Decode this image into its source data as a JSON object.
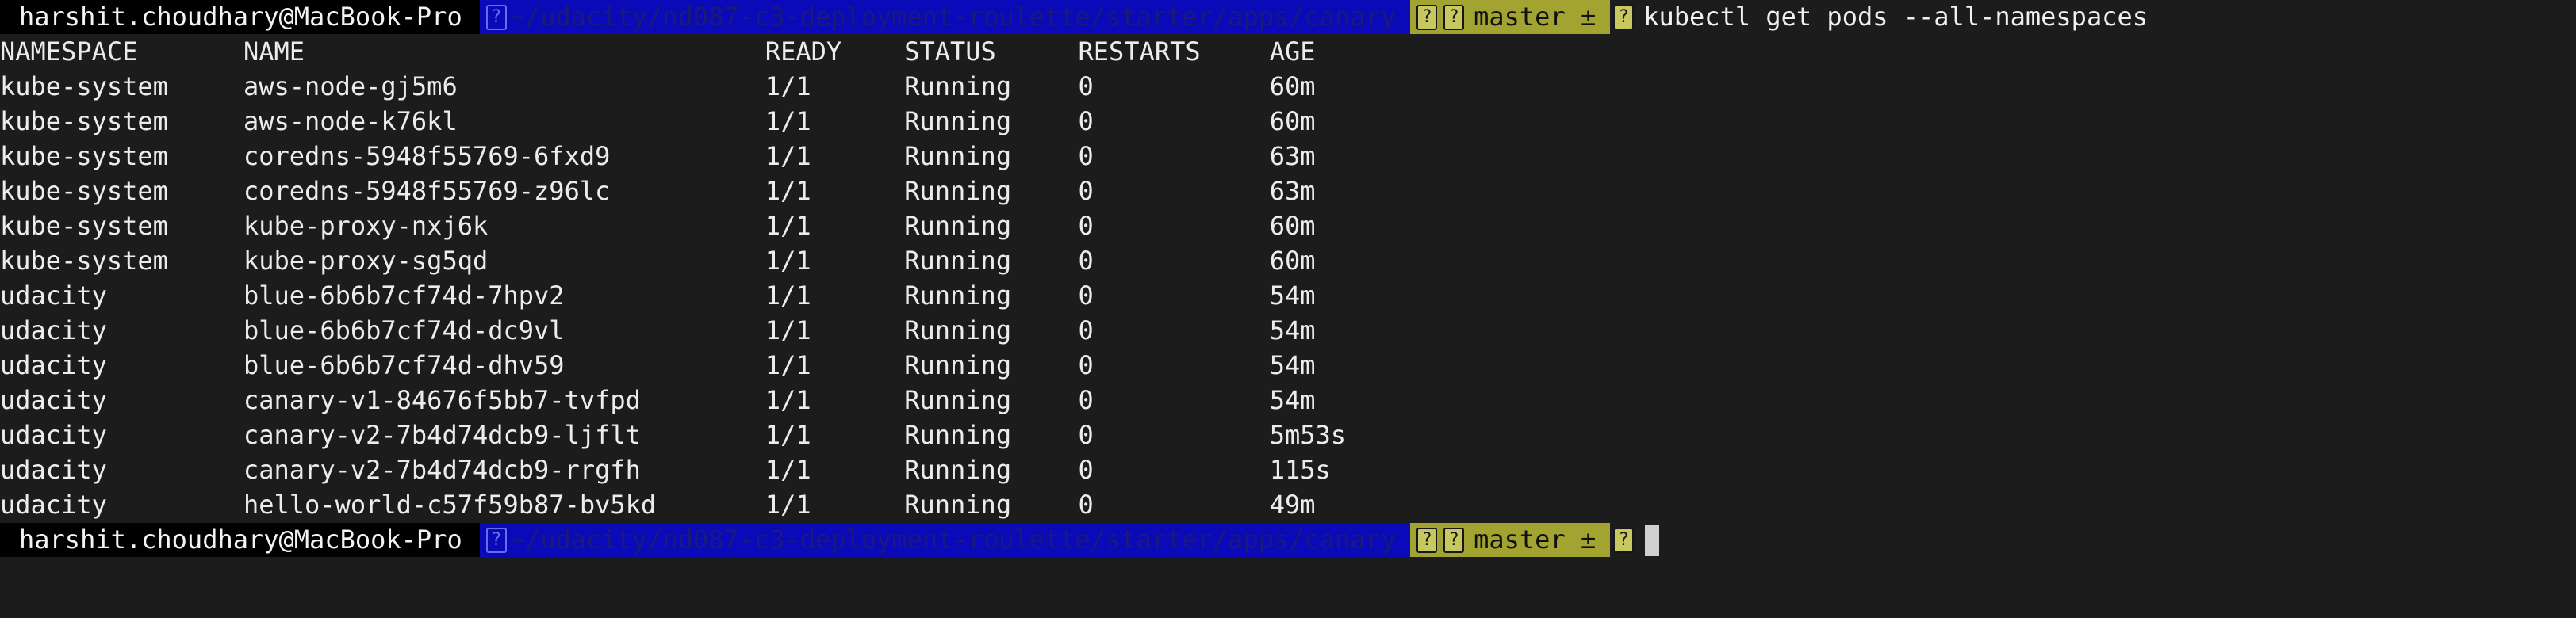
{
  "prompt": {
    "user_host": "harshit.choudhary@MacBook-Pro",
    "path": "~/udacity/nd087-c3-deployment-roulette/starter/apps/canary",
    "branch": "master ±",
    "command": "kubectl get pods --all-namespaces",
    "glyph": "?"
  },
  "table": {
    "headers": [
      "NAMESPACE",
      "NAME",
      "READY",
      "STATUS",
      "RESTARTS",
      "AGE"
    ],
    "rows": [
      [
        "kube-system",
        "aws-node-gj5m6",
        "1/1",
        "Running",
        "0",
        "60m"
      ],
      [
        "kube-system",
        "aws-node-k76kl",
        "1/1",
        "Running",
        "0",
        "60m"
      ],
      [
        "kube-system",
        "coredns-5948f55769-6fxd9",
        "1/1",
        "Running",
        "0",
        "63m"
      ],
      [
        "kube-system",
        "coredns-5948f55769-z96lc",
        "1/1",
        "Running",
        "0",
        "63m"
      ],
      [
        "kube-system",
        "kube-proxy-nxj6k",
        "1/1",
        "Running",
        "0",
        "60m"
      ],
      [
        "kube-system",
        "kube-proxy-sg5qd",
        "1/1",
        "Running",
        "0",
        "60m"
      ],
      [
        "udacity",
        "blue-6b6b7cf74d-7hpv2",
        "1/1",
        "Running",
        "0",
        "54m"
      ],
      [
        "udacity",
        "blue-6b6b7cf74d-dc9vl",
        "1/1",
        "Running",
        "0",
        "54m"
      ],
      [
        "udacity",
        "blue-6b6b7cf74d-dhv59",
        "1/1",
        "Running",
        "0",
        "54m"
      ],
      [
        "udacity",
        "canary-v1-84676f5bb7-tvfpd",
        "1/1",
        "Running",
        "0",
        "54m"
      ],
      [
        "udacity",
        "canary-v2-7b4d74dcb9-ljflt",
        "1/1",
        "Running",
        "0",
        "5m53s"
      ],
      [
        "udacity",
        "canary-v2-7b4d74dcb9-rrgfh",
        "1/1",
        "Running",
        "0",
        "115s"
      ],
      [
        "udacity",
        "hello-world-c57f59b87-bv5kd",
        "1/1",
        "Running",
        "0",
        "49m"
      ]
    ]
  },
  "colors": {
    "background": "#1c1c1c",
    "user_segment": "#000000",
    "path_segment": "#0a0ab8",
    "git_segment": "#a3a332"
  }
}
